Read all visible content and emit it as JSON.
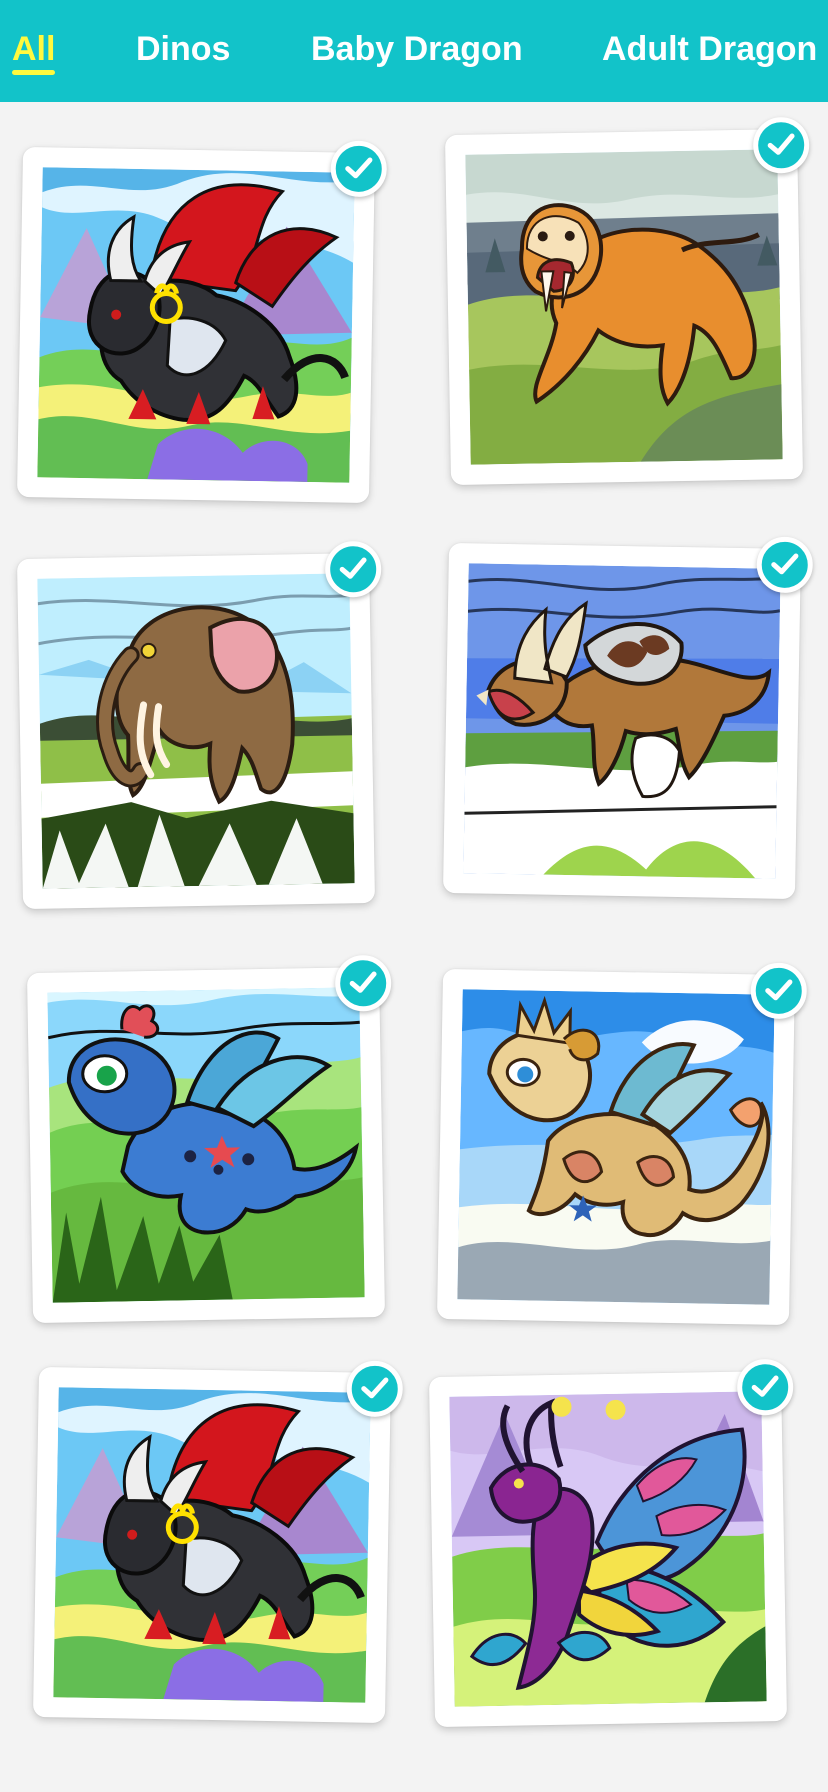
{
  "tabs": [
    {
      "label": "All",
      "selected": true
    },
    {
      "label": "Dinos",
      "selected": false
    },
    {
      "label": "Baby Dragon",
      "selected": false
    },
    {
      "label": "Adult Dragon",
      "selected": false
    }
  ],
  "colors": {
    "tab_bar": "#12c3c9",
    "selected_tab": "#fff93f",
    "tab_text": "#ffffff",
    "background": "#f3f3f3",
    "check_badge": "#12c3c9"
  },
  "gallery": {
    "items": [
      {
        "subject": "black winged bull-horned dragon",
        "completed": true,
        "icon": "checkmark-icon"
      },
      {
        "subject": "sabre-toothed cat",
        "completed": true,
        "icon": "checkmark-icon"
      },
      {
        "subject": "woolly mammoth",
        "completed": true,
        "icon": "checkmark-icon"
      },
      {
        "subject": "triceratops",
        "completed": true,
        "icon": "checkmark-icon"
      },
      {
        "subject": "blue baby dragon",
        "completed": true,
        "icon": "checkmark-icon"
      },
      {
        "subject": "golden baby dragon",
        "completed": true,
        "icon": "checkmark-icon"
      },
      {
        "subject": "black winged bull-horned dragon",
        "completed": true,
        "icon": "checkmark-icon"
      },
      {
        "subject": "butterfly-winged adult dragon",
        "completed": true,
        "icon": "checkmark-icon"
      }
    ]
  }
}
